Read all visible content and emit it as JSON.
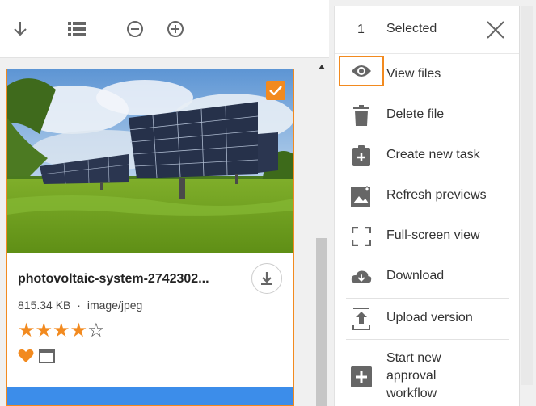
{
  "toolbar": {
    "buttons": [
      {
        "icon": "arrow-down-icon"
      },
      {
        "icon": "list-view-icon"
      },
      {
        "icon": "zoom-out-icon"
      },
      {
        "icon": "zoom-in-icon"
      }
    ]
  },
  "card": {
    "filename": "photovoltaic-system-2742302...",
    "size": "815.34 KB",
    "separator": "·",
    "type": "image/jpeg",
    "rating": 4,
    "rating_max": 5,
    "favorite": true
  },
  "panel": {
    "selected_count": "1",
    "selected_label": "Selected",
    "menu": [
      {
        "label": "View files",
        "icon": "eye-icon",
        "active": true
      },
      {
        "label": "Delete file",
        "icon": "trash-icon"
      },
      {
        "label": "Create new task",
        "icon": "clipboard-plus-icon"
      },
      {
        "label": "Refresh previews",
        "icon": "image-refresh-icon"
      },
      {
        "label": "Full-screen view",
        "icon": "fullscreen-icon"
      },
      {
        "label": "Download",
        "icon": "cloud-download-icon"
      },
      {
        "label": "Upload version",
        "icon": "upload-icon"
      }
    ],
    "approval": {
      "line1": "Start new",
      "line2": "approval",
      "line3": "workflow",
      "icon": "add-box-icon"
    }
  },
  "colors": {
    "accent": "#f28a1f",
    "blue_bar": "#3c8dea",
    "icon_gray": "#666666"
  }
}
